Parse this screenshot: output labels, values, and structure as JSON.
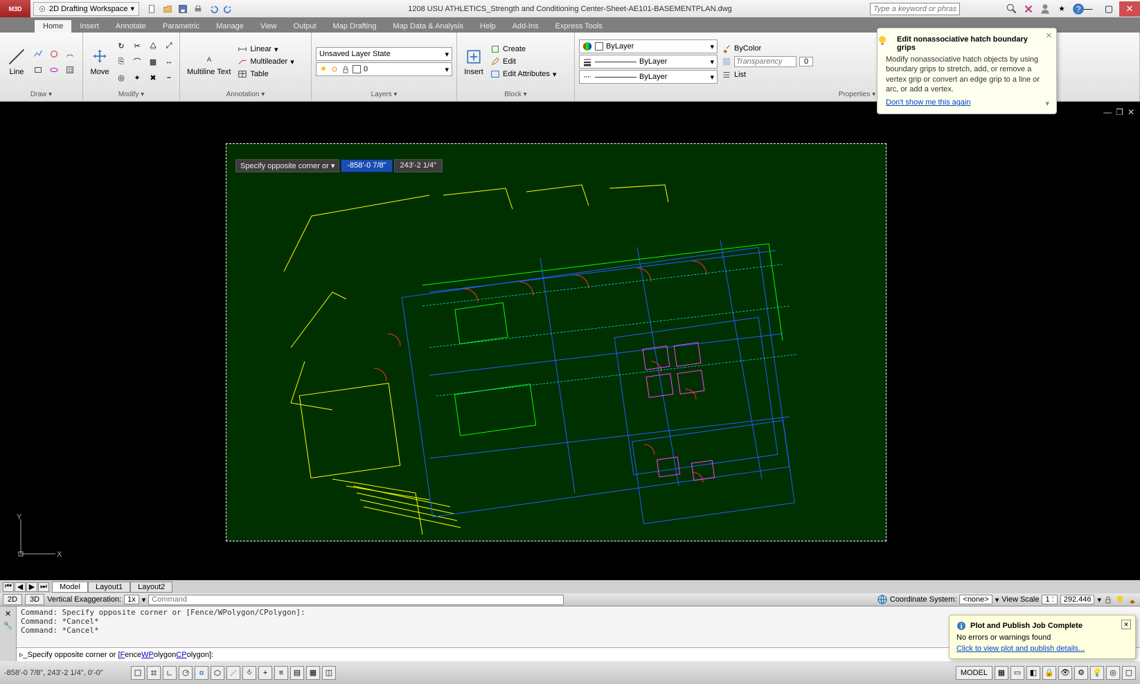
{
  "title": "1208 USU ATHLETICS_Strength and Conditioning Center-Sheet-AE101-BASEMENTPLAN.dwg",
  "workspace": "2D Drafting Workspace",
  "search_placeholder": "Type a keyword or phrase",
  "ribbon_tabs": [
    "Home",
    "Insert",
    "Annotate",
    "Parametric",
    "Manage",
    "View",
    "Output",
    "Map Drafting",
    "Map Data & Analysis",
    "Help",
    "Add-Ins",
    "Express Tools"
  ],
  "active_tab": "Home",
  "panels": {
    "draw": {
      "title": "Draw",
      "line": "Line"
    },
    "modify": {
      "title": "Modify",
      "move": "Move"
    },
    "annotation": {
      "title": "Annotation",
      "mtext": "Multiline Text",
      "linear": "Linear",
      "mleader": "Multileader",
      "table": "Table"
    },
    "layers": {
      "title": "Layers",
      "state": "Unsaved Layer State",
      "layer0": "0"
    },
    "block": {
      "title": "Block",
      "insert": "Insert",
      "create": "Create",
      "edit": "Edit",
      "editattr": "Edit Attributes"
    },
    "properties": {
      "title": "Properties",
      "bylayer": "ByLayer",
      "bycolor": "ByColor",
      "transparency": "Transparency",
      "transval": "0",
      "list": "List"
    }
  },
  "dyn_prompt": "Specify opposite corner or",
  "dyn_val1": "-858'-0 7/8\"",
  "dyn_val2": "243'-2 1/4\"",
  "layout_tabs": [
    "Model",
    "Layout1",
    "Layout2"
  ],
  "csbar": {
    "b2d": "2D",
    "b3d": "3D",
    "ve": "Vertical Exaggeration:",
    "vx": "1x",
    "cmd": "Command",
    "cs": "Coordinate System:",
    "csv": "<none>",
    "vs": "View Scale",
    "vs1": "1 :",
    "vs2": "292.446"
  },
  "cmd_history": "Command: Specify opposite corner or [Fence/WPolygon/CPolygon]:\nCommand: *Cancel*\nCommand: *Cancel*",
  "cmd_prompt_pre": "Specify opposite corner or [",
  "cmd_prompt_f": "F",
  "cmd_prompt_fence": "ence ",
  "cmd_prompt_w": "WP",
  "cmd_prompt_wp": "olygon ",
  "cmd_prompt_c": "CP",
  "cmd_prompt_cp": "olygon",
  "cmd_prompt_end": "]:",
  "status_coord": "-858'-0 7/8\", 243'-2 1/4\", 0'-0\"",
  "status_model": "MODEL",
  "tooltip": {
    "title": "Edit nonassociative hatch boundary grips",
    "body": "Modify nonassociative hatch objects by using boundary grips to stretch, add, or remove a vertex grip or convert an edge grip to a line or arc, or add a vertex.",
    "link": "Don't show me this again"
  },
  "notify": {
    "title": "Plot and Publish Job Complete",
    "body": "No errors or warnings found",
    "link": "Click to view plot and publish details..."
  }
}
